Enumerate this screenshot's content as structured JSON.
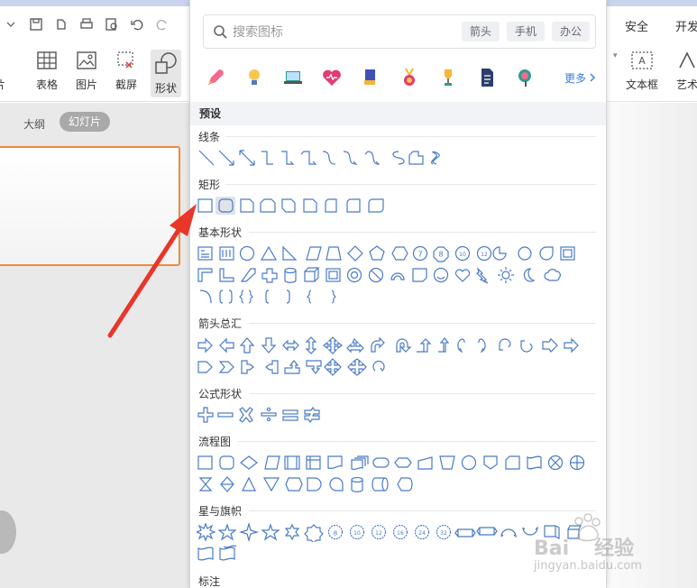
{
  "menu_right": [
    "安全",
    "开发"
  ],
  "ribbon_left": [
    {
      "label": "片",
      "icon": "image-icon"
    },
    {
      "label": "表格",
      "icon": "table-icon"
    },
    {
      "label": "图片",
      "icon": "picture-icon"
    },
    {
      "label": "截屏",
      "icon": "screenshot-icon"
    },
    {
      "label": "形状",
      "icon": "shapes-icon"
    }
  ],
  "ribbon_right": [
    {
      "label": "文本框",
      "icon": "textbox-icon"
    },
    {
      "label": "艺术",
      "icon": "art-text-icon"
    }
  ],
  "left_pane": {
    "outline_tab": "大纲",
    "slides_tab": "幻灯片"
  },
  "panel": {
    "search_placeholder": "搜索图标",
    "search_chips": [
      "箭头",
      "手机",
      "办公"
    ],
    "category_icons": [
      "rocket-icon",
      "lightbulb-icon",
      "laptop-icon",
      "heart-icon",
      "books-icon",
      "medal-icon",
      "trophy-icon",
      "document-icon",
      "magnifier-icon"
    ],
    "more_label": "更多",
    "preset_header": "预设",
    "categories": [
      {
        "name": "线条"
      },
      {
        "name": "矩形"
      },
      {
        "name": "基本形状"
      },
      {
        "name": "箭头总汇"
      },
      {
        "name": "公式形状"
      },
      {
        "name": "流程图"
      },
      {
        "name": "星与旗帜"
      },
      {
        "name": "标注"
      }
    ]
  },
  "watermark": {
    "brand": "Bai",
    "brand_zh": "经验",
    "url": "jingyan.baidu.com"
  },
  "colors": {
    "shape_stroke": "#4a7bc8",
    "accent_orange": "#f08a3c",
    "arrow_red": "#e8362b",
    "link_blue": "#3a7be0"
  }
}
